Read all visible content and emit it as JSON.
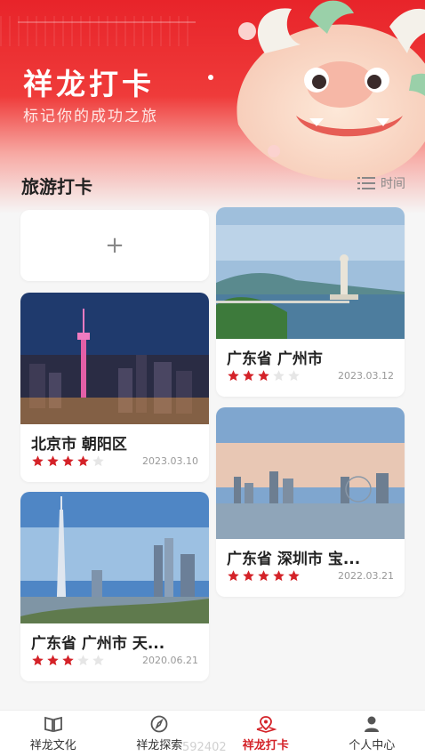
{
  "header": {
    "title": "祥龙打卡",
    "subtitle": "标记你的成功之旅"
  },
  "section": {
    "title": "旅游打卡",
    "sort_label": "时间"
  },
  "add_card": {
    "label": "+"
  },
  "cards": [
    {
      "title": "广东省 广州市",
      "rating": 3,
      "date": "2023.03.12"
    },
    {
      "title": "北京市 朝阳区",
      "rating": 4,
      "date": "2023.03.10"
    },
    {
      "title": "广东省 深圳市 宝...",
      "rating": 5,
      "date": "2022.03.21"
    },
    {
      "title": "广东省 广州市 天...",
      "rating": 3,
      "date": "2020.06.21"
    }
  ],
  "colors": {
    "accent": "#d42228",
    "star_on": "#d42228",
    "star_off": "#e6e6e6"
  },
  "tabbar": {
    "items": [
      {
        "label": "祥龙文化",
        "icon": "book-icon"
      },
      {
        "label": "祥龙探索",
        "icon": "compass-icon"
      },
      {
        "label": "祥龙打卡",
        "icon": "map-pin-icon"
      },
      {
        "label": "个人中心",
        "icon": "person-icon"
      }
    ],
    "active_index": 2
  },
  "watermark": "592402"
}
